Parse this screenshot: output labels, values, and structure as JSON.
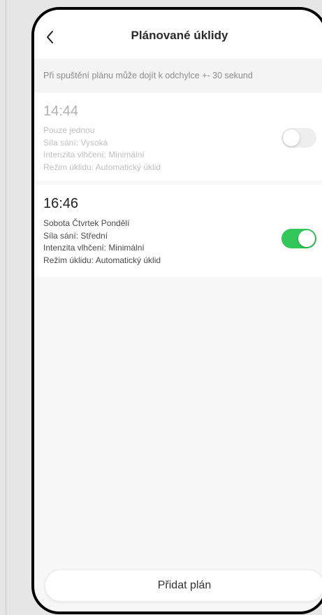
{
  "header": {
    "title": "Plánované úklidy",
    "back_icon": "chevron-left-icon"
  },
  "notice": {
    "text": "Při spuštění plánu může dojít k odchylce +- 30 sekund"
  },
  "plans": [
    {
      "time": "14:44",
      "repeat": "Pouze jednou",
      "suction": "Síla sání: Vysoká",
      "mopping": "Intenzita vlhčení: Minimální",
      "mode": "Režim úklidu: Automatický úklid",
      "enabled": false
    },
    {
      "time": "16:46",
      "repeat": "Sobota Čtvrtek Pondělí",
      "suction": "Síla sání: Střední",
      "mopping": "Intenzita vlhčení: Minimální",
      "mode": "Režim úklidu: Automatický úklid",
      "enabled": true
    }
  ],
  "footer": {
    "add_label": "Přidat plán"
  },
  "colors": {
    "toggle_on": "#32c759",
    "toggle_off": "#eeeeee",
    "background": "#f7f7f7"
  }
}
